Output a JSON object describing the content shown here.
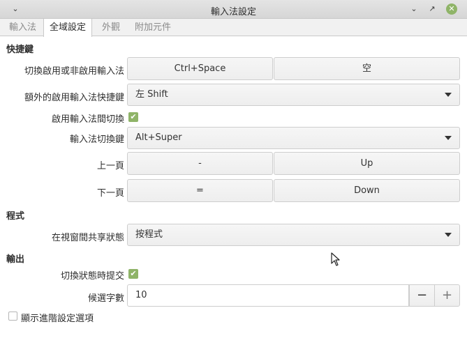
{
  "window": {
    "title": "輸入法設定",
    "menu_icon": "chevron-down-icon",
    "minimize_icon": "minimize-icon",
    "maximize_icon": "maximize-icon",
    "close_icon": "close-icon"
  },
  "tabs": [
    {
      "label": "輸入法",
      "active": false
    },
    {
      "label": "全域設定",
      "active": true
    },
    {
      "label": "外觀",
      "active": false
    },
    {
      "label": "附加元件",
      "active": false
    }
  ],
  "sections": {
    "shortcuts": "快捷鍵",
    "program": "程式",
    "output": "輸出"
  },
  "shortcuts": {
    "toggle_label": "切換啟用或非啟用輸入法",
    "toggle_key1": "Ctrl+Space",
    "toggle_key2": "空",
    "extra_label": "額外的啟用輸入法快捷鍵",
    "extra_value": "左 Shift",
    "enable_switch_label": "啟用輸入法間切換",
    "enable_switch_checked": true,
    "switch_key_label": "輸入法切換鍵",
    "switch_key_value": "Alt+Super",
    "prev_page_label": "上一頁",
    "prev_key1": "-",
    "prev_key2": "Up",
    "next_page_label": "下一頁",
    "next_key1": "=",
    "next_key2": "Down"
  },
  "program": {
    "share_label": "在視窗間共享狀態",
    "share_value": "按程式"
  },
  "output": {
    "commit_label": "切換狀態時提交",
    "commit_checked": true,
    "candidates_label": "候選字數",
    "candidates_value": "10",
    "minus": "−",
    "plus": "+"
  },
  "advanced": {
    "label": "顯示進階設定選項",
    "checked": false
  },
  "colors": {
    "accent": "#8fb468",
    "titlebar": "#dcdcdc"
  }
}
